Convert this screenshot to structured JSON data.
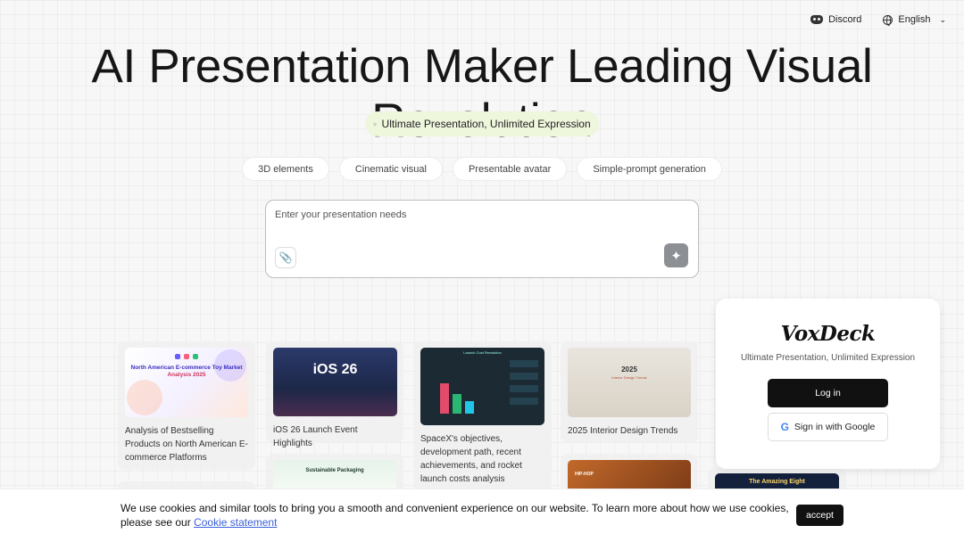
{
  "topbar": {
    "discord": "Discord",
    "language": "English"
  },
  "hero": {
    "title": "AI Presentation Maker Leading Visual Revolution",
    "tagline": "Ultimate Presentation, Unlimited Expression"
  },
  "chips": [
    "3D elements",
    "Cinematic visual",
    "Presentable avatar",
    "Simple-prompt generation"
  ],
  "prompt": {
    "placeholder": "Enter your presentation needs"
  },
  "cards": {
    "c1": {
      "thumb_title": "North American E-commerce Toy Market",
      "thumb_subtitle": "Analysis 2025",
      "caption": "Analysis of Bestselling Products on North American E-commerce Platforms"
    },
    "c2": {
      "thumb_title": "iOS 26",
      "caption": "iOS 26 Launch Event Highlights"
    },
    "c3": {
      "thumb_title": "Launch Cost Revolution",
      "caption": "SpaceX's objectives, development path, recent achievements, and rocket launch costs analysis"
    },
    "c4": {
      "thumb_title": "2025",
      "thumb_subtitle": "Interior Design Trends",
      "caption": "2025 Interior Design Trends"
    },
    "c5": {
      "thumb_title": "Sustainable Packaging"
    },
    "c6": {
      "thumb_title": "HIP-HOP"
    },
    "c7": {
      "thumb_title": "The Amazing Eight"
    }
  },
  "login": {
    "logo": "VoxDeck",
    "tagline": "Ultimate Presentation, Unlimited Expression",
    "login_label": "Log in",
    "google_label": "Sign in with Google"
  },
  "cookie": {
    "text": "We use cookies and similar tools to bring you a smooth and convenient experience on our website. To learn more about how we use cookies, please see our ",
    "link": "Cookie statement",
    "accept": "accept"
  }
}
